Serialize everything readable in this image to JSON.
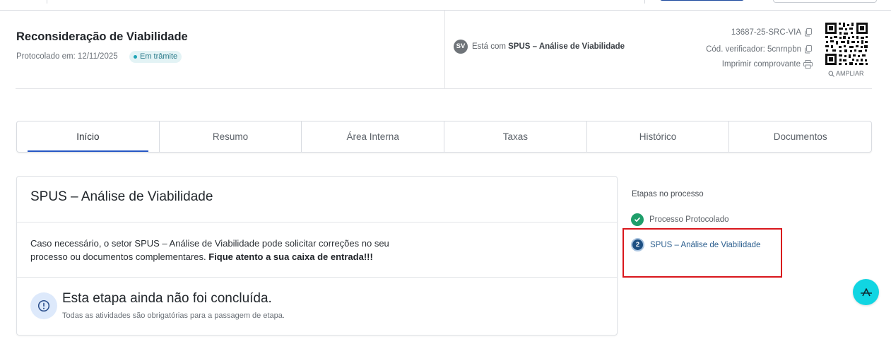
{
  "header": {
    "title": "Reconsideração de Viabilidade",
    "protocol": "Protocolado em: 12/11/2025",
    "status_badge": "Em trâmite",
    "avatar_initials": "SV",
    "with_prefix": "Está com",
    "with_value": "SPUS – Análise de Viabilidade",
    "process_code": "13687-25-SRC-VIA",
    "verifier": "Cód. verificador: 5cnrnpbn",
    "print_receipt": "Imprimir comprovante",
    "ampliar": "AMPLIAR"
  },
  "tabs": [
    {
      "label": "Início",
      "active": true
    },
    {
      "label": "Resumo",
      "active": false
    },
    {
      "label": "Área Interna",
      "active": false
    },
    {
      "label": "Taxas",
      "active": false
    },
    {
      "label": "Histórico",
      "active": false
    },
    {
      "label": "Documentos",
      "active": false
    }
  ],
  "card": {
    "title": "SPUS – Análise de Viabilidade",
    "text": "Caso necessário, o setor SPUS – Análise de Viabilidade pode solicitar correções no seu processo ou documentos complementares.",
    "text_bold": "Fique atento a sua caixa de entrada!!!",
    "notice_title": "Esta etapa ainda não foi concluída.",
    "notice_sub": "Todas as atividades são obrigatórias para a passagem de etapa."
  },
  "steps": {
    "title": "Etapas no processo",
    "items": [
      {
        "label": "Processo Protocolado",
        "status": "done"
      },
      {
        "label": "SPUS – Análise de Viabilidade",
        "status": "current",
        "number": "2"
      }
    ]
  },
  "colors": {
    "accent": "#2557c4",
    "badge_bg": "#e3f3f5",
    "step_done": "#1e9e6a",
    "step_current": "#1d4f82",
    "highlight": "#d9161c",
    "fab": "#11d5e2"
  },
  "icons": [
    "copy-icon",
    "printer-icon",
    "qr-code-icon",
    "search-icon",
    "info-icon",
    "check-icon",
    "assistant-icon"
  ]
}
